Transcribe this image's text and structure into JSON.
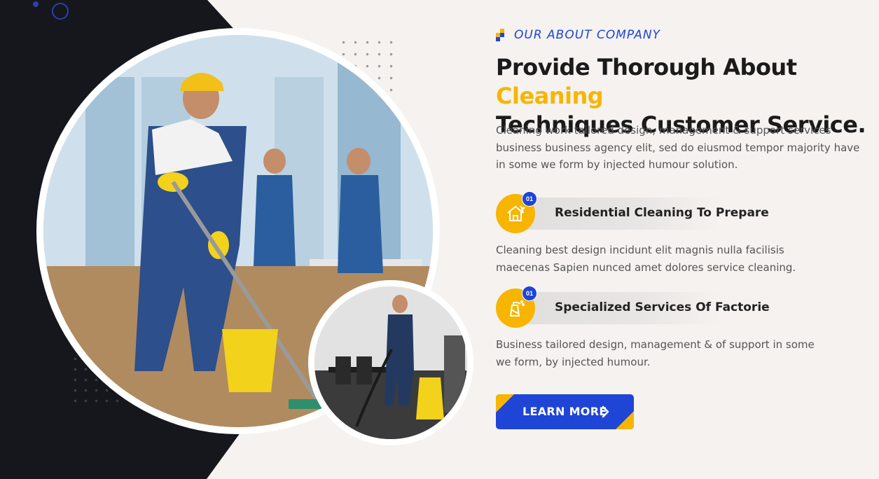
{
  "colors": {
    "accent_yellow": "#f7b500",
    "brand_blue": "#1f45d6",
    "dark": "#16171d",
    "bg": "#f5f2ef"
  },
  "hero": {
    "subtitle": "OUR ABOUT COMPANY",
    "title_part1": "Provide Thorough About ",
    "title_highlight": "Cleaning",
    "title_part2": "Techniques Customer Service.",
    "description": "Cleaning work tailored design, management & support services business business agency elit, sed do eiusmod tempor  majority have in some we form by injected humour solution."
  },
  "features": [
    {
      "number": "01",
      "title": "Residential Cleaning To Prepare",
      "icon": "house-cleaning-icon",
      "description": "Cleaning best design incidunt elit magnis nulla facilisis maecenas Sapien nunced amet dolores service cleaning."
    },
    {
      "number": "01",
      "title": "Specialized Services Of Factorie",
      "icon": "spray-bottle-icon",
      "description": "Business tailored design, management & of support in some we form, by injected humour."
    }
  ],
  "cta": {
    "label": "LEARN MORE",
    "icon": "chevron-right-icon"
  }
}
